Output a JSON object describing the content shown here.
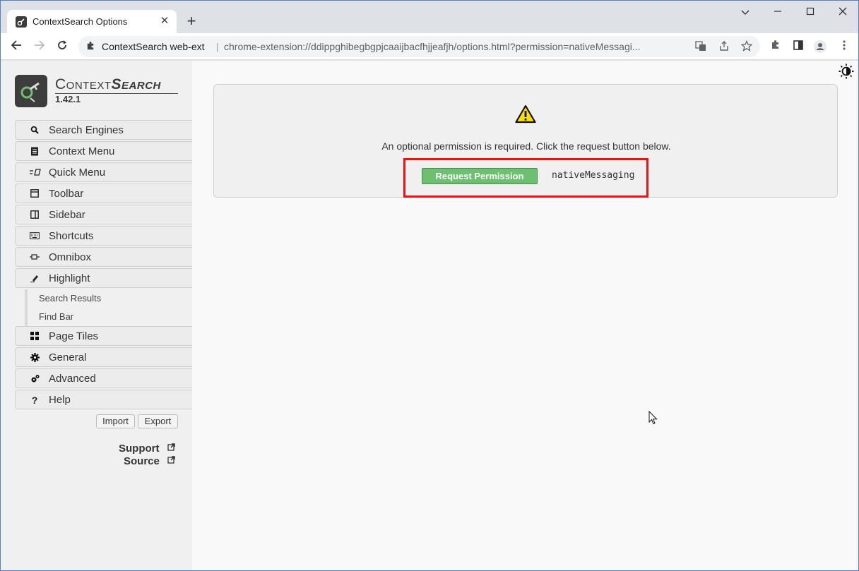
{
  "browser": {
    "tab_title": "ContextSearch Options",
    "tab_close": "✕",
    "new_tab": "+",
    "omnibox_site": "ContextSearch web-ext",
    "omnibox_url": "chrome-extension://ddippghibegbgpjcaaijbacfhjjeafjh/options.html?permission=nativeMessagi..."
  },
  "sidebar": {
    "brand_prefix": "Context",
    "brand_suffix": "Search",
    "version": "1.42.1",
    "items": [
      {
        "label": "Search Engines",
        "icon": "search-icon"
      },
      {
        "label": "Context Menu",
        "icon": "context-menu-icon"
      },
      {
        "label": "Quick Menu",
        "icon": "quick-menu-icon"
      },
      {
        "label": "Toolbar",
        "icon": "toolbar-icon"
      },
      {
        "label": "Sidebar",
        "icon": "sidebar-icon"
      },
      {
        "label": "Shortcuts",
        "icon": "keyboard-icon"
      },
      {
        "label": "Omnibox",
        "icon": "omnibox-icon"
      },
      {
        "label": "Highlight",
        "icon": "highlight-icon"
      }
    ],
    "sub_items": [
      {
        "label": "Search Results"
      },
      {
        "label": "Find Bar"
      }
    ],
    "items2": [
      {
        "label": "Page Tiles",
        "icon": "tiles-icon"
      },
      {
        "label": "General",
        "icon": "gear-icon"
      },
      {
        "label": "Advanced",
        "icon": "gears-icon"
      },
      {
        "label": "Help",
        "icon": "help-icon"
      }
    ],
    "import_label": "Import",
    "export_label": "Export",
    "support_label": "Support",
    "source_label": "Source"
  },
  "main": {
    "message": "An optional permission is required. Click the request button below.",
    "request_button": "Request Permission",
    "permission": "nativeMessaging"
  }
}
